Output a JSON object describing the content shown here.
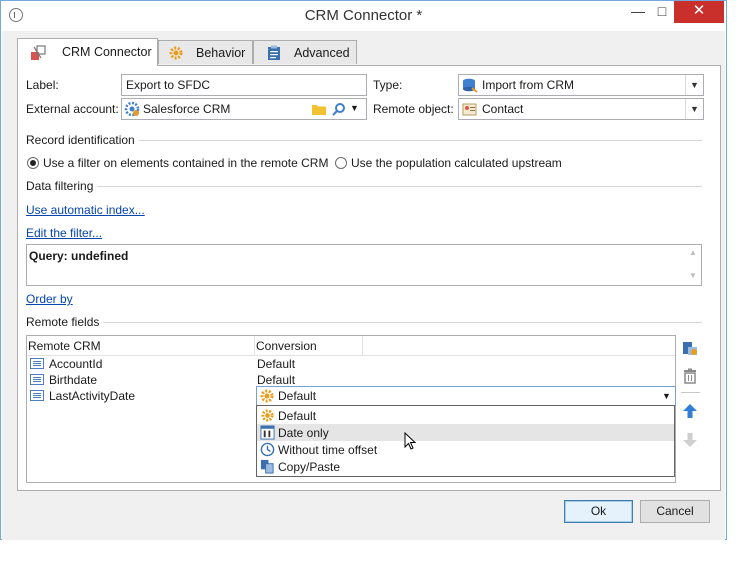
{
  "window": {
    "title": "CRM Connector *",
    "minimize": "—",
    "maximize": "□",
    "close": "✕"
  },
  "tabs": [
    {
      "label": "CRM Connector",
      "active": true,
      "icon": "crm-connector-icon"
    },
    {
      "label": "Behavior",
      "active": false,
      "icon": "gear-icon"
    },
    {
      "label": "Advanced",
      "active": false,
      "icon": "clipboard-icon"
    }
  ],
  "form": {
    "label_caption": "Label:",
    "label_value": "Export to SFDC",
    "type_caption": "Type:",
    "type_value": "Import from CRM",
    "external_account_caption": "External account:",
    "external_account_value": "Salesforce CRM",
    "remote_object_caption": "Remote object:",
    "remote_object_value": "Contact"
  },
  "record_identification": {
    "title": "Record identification",
    "option_filter": "Use a filter on elements contained in the remote CRM",
    "option_population": "Use the population calculated upstream",
    "selected": "option_filter"
  },
  "data_filtering": {
    "title": "Data filtering",
    "auto_index_link": "Use automatic index...",
    "edit_filter_link": "Edit the filter...",
    "query_text": "Query: undefined",
    "order_by_link": "Order by"
  },
  "remote_fields": {
    "title": "Remote fields",
    "columns": [
      "Remote CRM",
      "Conversion"
    ],
    "rows": [
      {
        "field": "AccountId",
        "conversion": "Default"
      },
      {
        "field": "Birthdate",
        "conversion": "Default"
      },
      {
        "field": "LastActivityDate",
        "conversion": "Default"
      }
    ],
    "dropdown_options": [
      "Default",
      "Date only",
      "Without time offset",
      "Copy/Paste"
    ],
    "hovered_option": "Date only"
  },
  "buttons": {
    "ok": "Ok",
    "cancel": "Cancel"
  },
  "colors": {
    "link": "#0645ad",
    "close_button": "#c9302c",
    "window_border": "#74a9dc"
  }
}
